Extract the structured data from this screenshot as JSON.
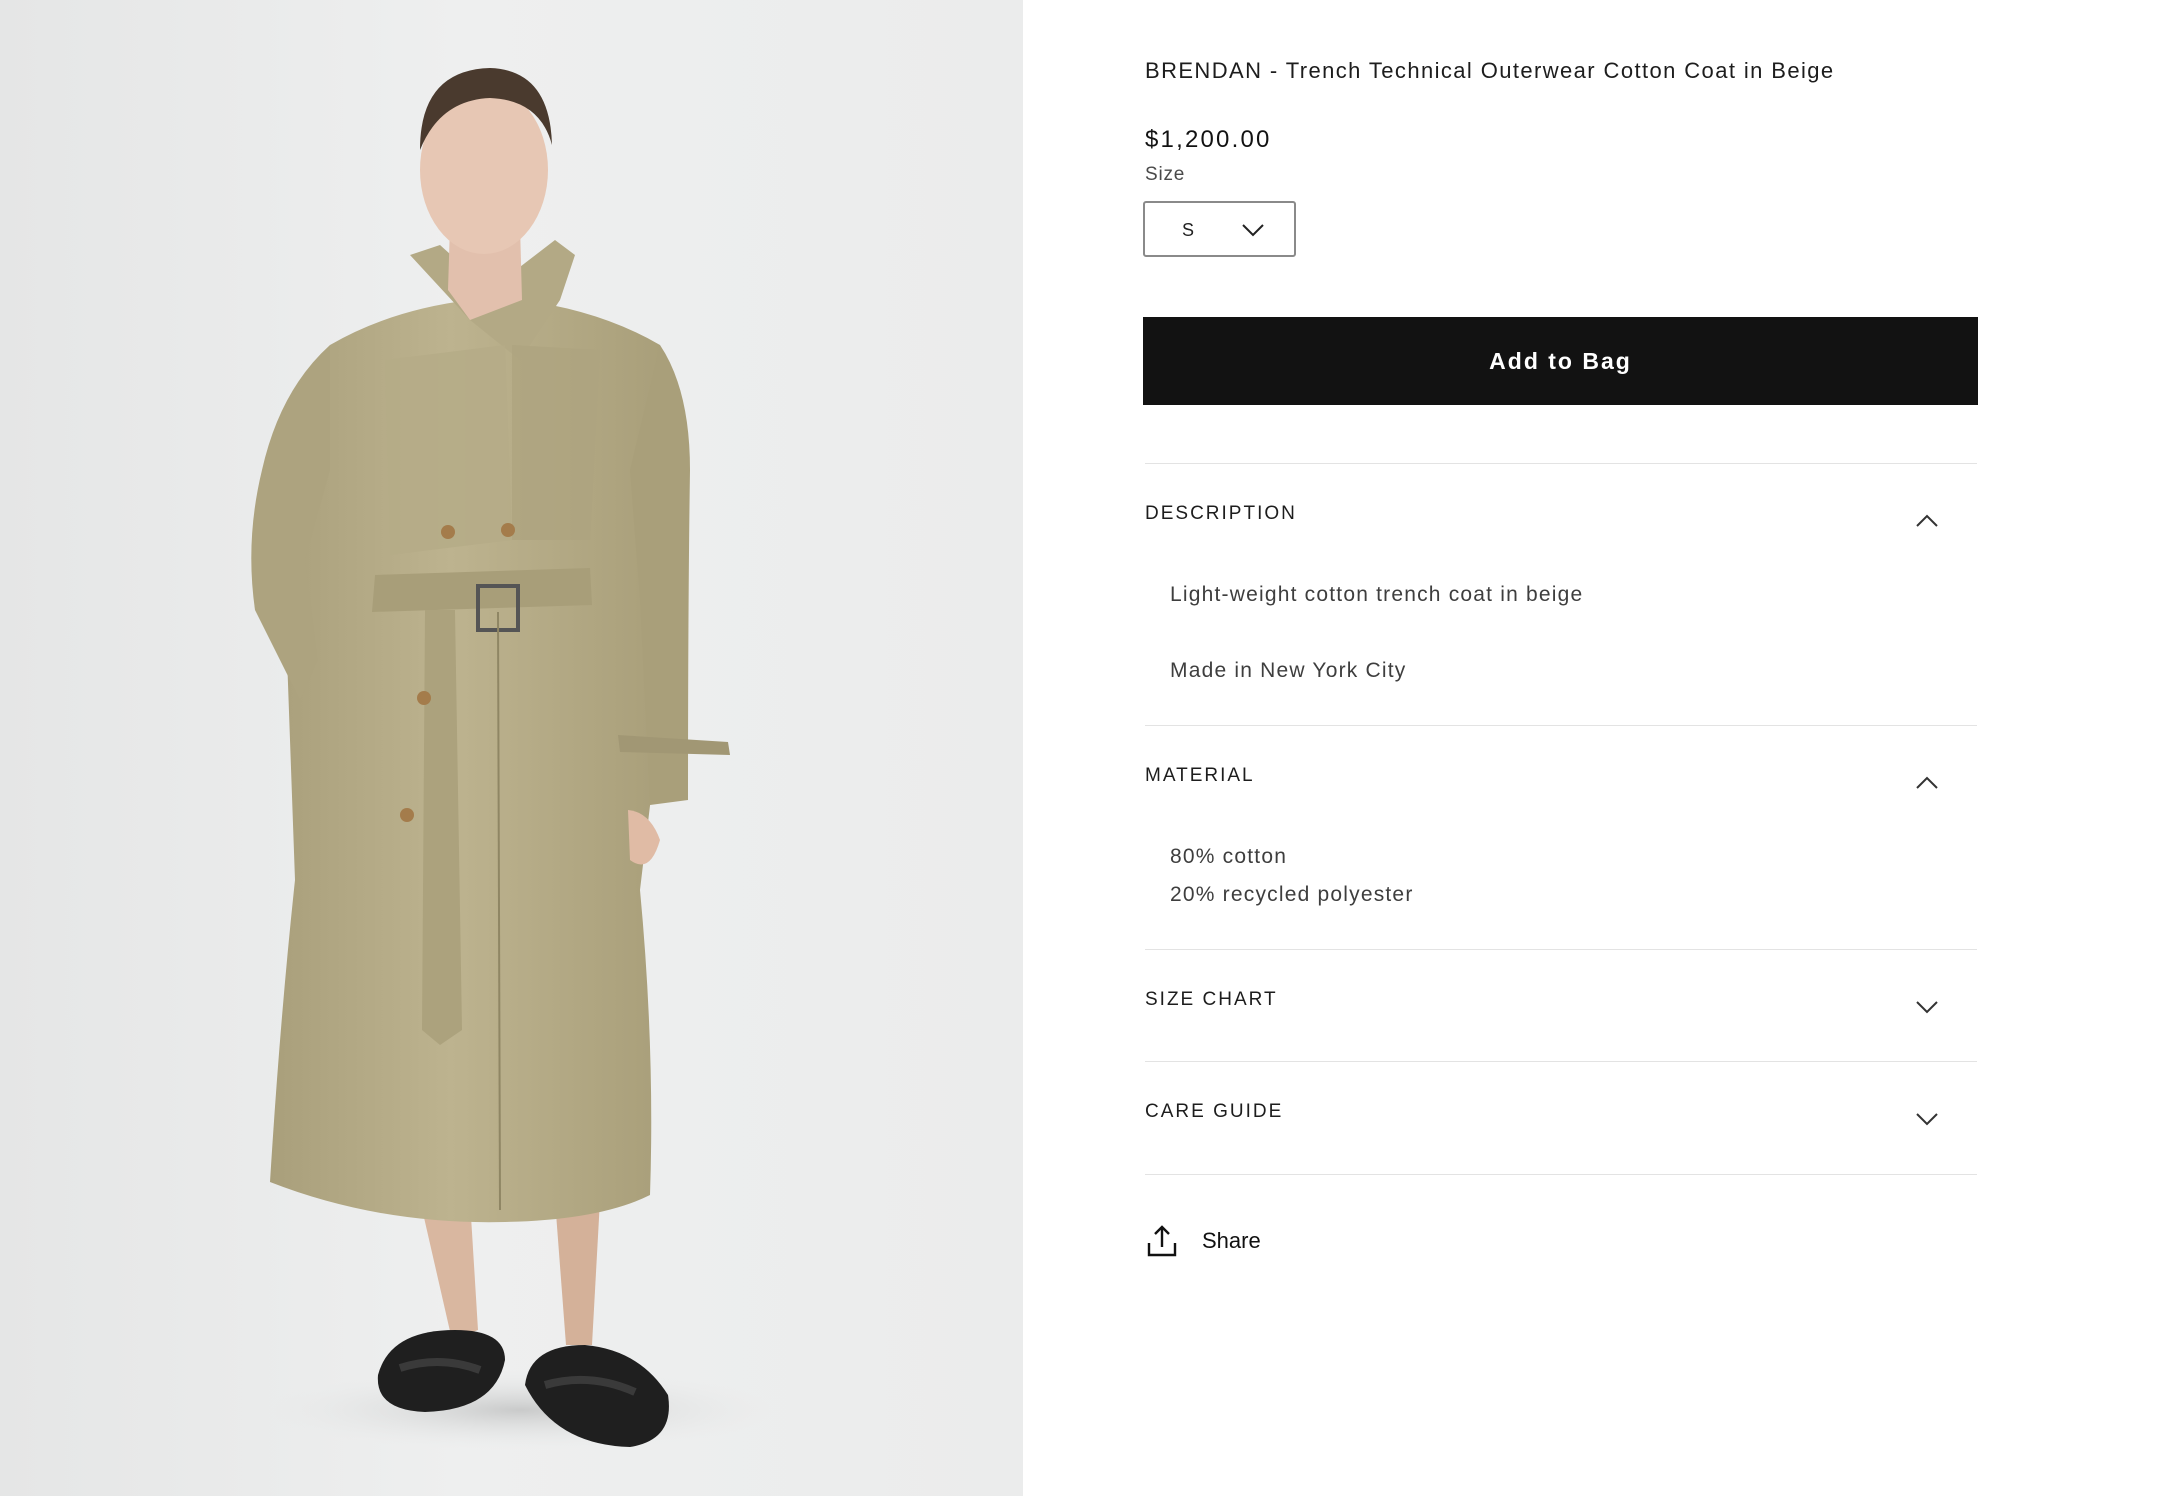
{
  "product": {
    "title": "BRENDAN - Trench Technical Outerwear Cotton Coat in Beige",
    "price": "$1,200.00",
    "size_label": "Size",
    "size_selected": "S",
    "add_to_bag_label": "Add to Bag"
  },
  "accordions": {
    "description": {
      "title": "DESCRIPTION",
      "expanded": true,
      "lines": [
        "Light-weight cotton trench coat in beige",
        "Made in New York City"
      ]
    },
    "material": {
      "title": "MATERIAL",
      "expanded": true,
      "lines": [
        "80% cotton",
        "20% recycled polyester"
      ]
    },
    "size_chart": {
      "title": "SIZE CHART",
      "expanded": false
    },
    "care_guide": {
      "title": "CARE GUIDE",
      "expanded": false
    }
  },
  "share": {
    "label": "Share",
    "icon": "share-upload-icon"
  },
  "colors": {
    "button_bg": "#121212",
    "photo_bg": "#e9eaea",
    "coat": "#b8ae8a"
  }
}
